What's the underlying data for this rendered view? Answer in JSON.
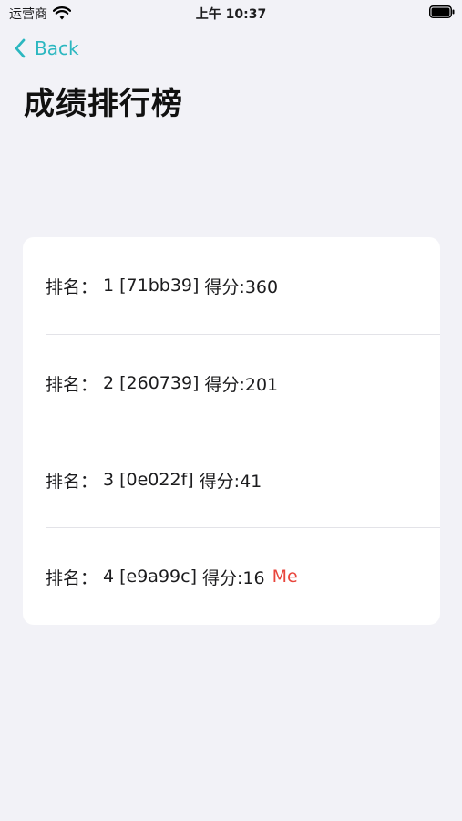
{
  "status_bar": {
    "carrier": "运营商",
    "time": "上午 10:37"
  },
  "nav": {
    "back_label": "Back"
  },
  "page": {
    "title": "成绩排行榜"
  },
  "leaderboard": {
    "rows": [
      {
        "rank_prefix": "排名：",
        "rank": "1",
        "player_id": "[71bb39]",
        "score_text": "得分:360",
        "tag": ""
      },
      {
        "rank_prefix": "排名：",
        "rank": "2",
        "player_id": "[260739]",
        "score_text": "得分:201",
        "tag": ""
      },
      {
        "rank_prefix": "排名：",
        "rank": "3",
        "player_id": "[0e022f]",
        "score_text": "得分:41",
        "tag": ""
      },
      {
        "rank_prefix": "排名：",
        "rank": "4",
        "player_id": "[e9a99c]",
        "score_text": "得分:16",
        "tag": "Me"
      }
    ]
  },
  "colors": {
    "accent": "#2bb7c0",
    "me_tag": "#e8453c",
    "background": "#f2f2f7",
    "card": "#ffffff"
  }
}
